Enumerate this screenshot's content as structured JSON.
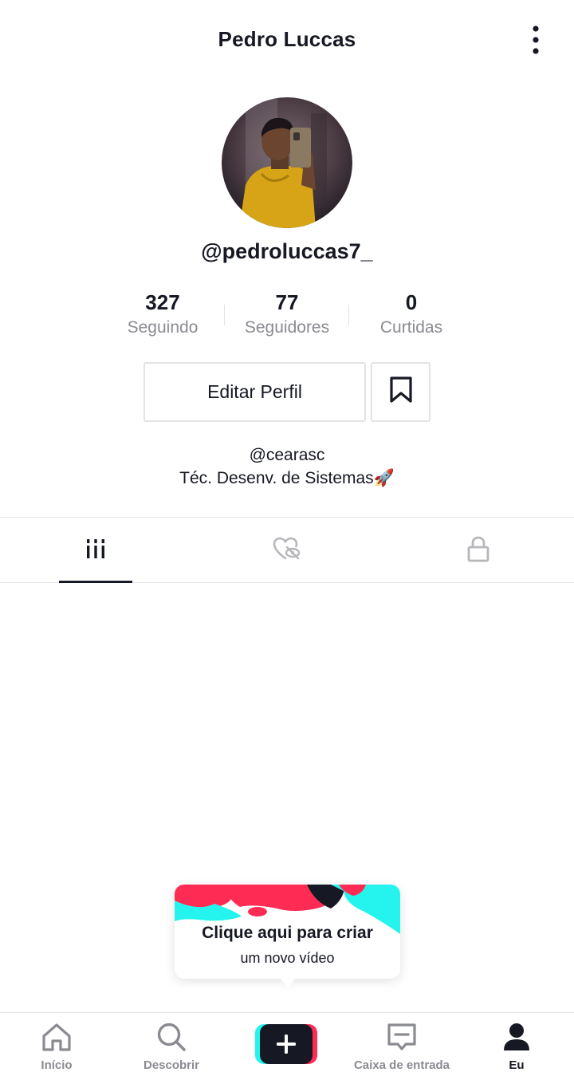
{
  "header": {
    "title": "Pedro Luccas",
    "more_icon": "more-vertical-icon"
  },
  "profile": {
    "handle": "@pedroluccas7_",
    "stats": [
      {
        "value": "327",
        "label": "Seguindo"
      },
      {
        "value": "77",
        "label": "Seguidores"
      },
      {
        "value": "0",
        "label": "Curtidas"
      }
    ],
    "edit_label": "Editar Perfil",
    "bio_line1": "@cearasc",
    "bio_line2": "Téc. Desenv. de Sistemas🚀"
  },
  "tabs": [
    {
      "icon": "grid-icon",
      "active": true
    },
    {
      "icon": "liked-hidden-icon",
      "active": false
    },
    {
      "icon": "lock-icon",
      "active": false
    }
  ],
  "tooltip": {
    "title": "Clique aqui para criar",
    "subtitle": "um novo vídeo"
  },
  "nav": [
    {
      "label": "Início",
      "icon": "home-icon"
    },
    {
      "label": "Descobrir",
      "icon": "search-icon"
    },
    {
      "label": "",
      "icon": "create-plus-icon"
    },
    {
      "label": "Caixa de entrada",
      "icon": "inbox-icon"
    },
    {
      "label": "Eu",
      "icon": "profile-icon",
      "active": true
    }
  ],
  "colors": {
    "text": "#161823",
    "muted": "#8a8b91",
    "cyan": "#25F4EE",
    "pink": "#FE2C55",
    "border": "#e3e3e5"
  }
}
